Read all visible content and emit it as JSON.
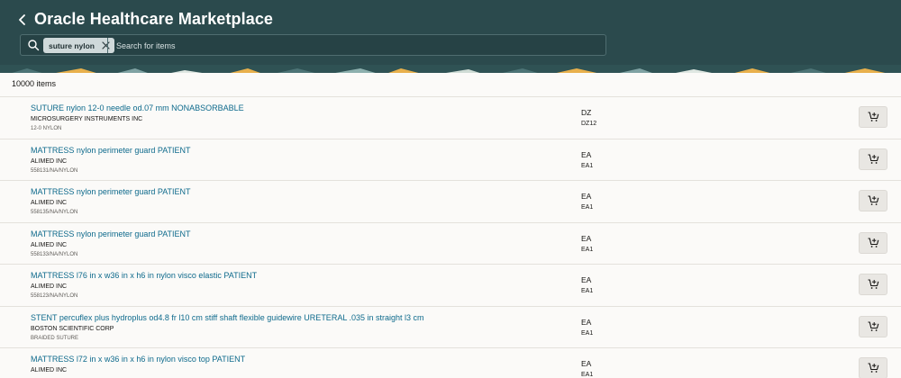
{
  "header": {
    "title": "Oracle Healthcare Marketplace",
    "back_icon": "chevron-left-icon"
  },
  "search": {
    "icon": "search-icon",
    "chip_label": "suture nylon",
    "placeholder": "Search for items",
    "value": ""
  },
  "results": {
    "count_label": "10000 items",
    "items": [
      {
        "title": "SUTURE nylon 12-0 needle od.07 mm NONABSORBABLE",
        "vendor": "MICROSURGERY INSTRUMENTS INC",
        "sku": "12-0 NYLON",
        "uom": "DZ",
        "pack": "DZ12"
      },
      {
        "title": "MATTRESS nylon perimeter guard PATIENT",
        "vendor": "ALIMED INC",
        "sku": "558131/NA/NYLON",
        "uom": "EA",
        "pack": "EA1"
      },
      {
        "title": "MATTRESS nylon perimeter guard PATIENT",
        "vendor": "ALIMED INC",
        "sku": "558135/NA/NYLON",
        "uom": "EA",
        "pack": "EA1"
      },
      {
        "title": "MATTRESS nylon perimeter guard PATIENT",
        "vendor": "ALIMED INC",
        "sku": "558133/NA/NYLON",
        "uom": "EA",
        "pack": "EA1"
      },
      {
        "title": "MATTRESS l76 in x w36 in x h6 in nylon visco elastic PATIENT",
        "vendor": "ALIMED INC",
        "sku": "558123/NA/NYLON",
        "uom": "EA",
        "pack": "EA1"
      },
      {
        "title": "STENT percuflex plus hydroplus od4.8 fr l10 cm stiff shaft flexible guidewire URETERAL .035 in straight l3 cm",
        "vendor": "BOSTON SCIENTIFIC CORP",
        "sku": "BRAIDED SUTURE",
        "uom": "EA",
        "pack": "EA1"
      },
      {
        "title": "MATTRESS l72 in x w36 in x h6 in nylon visco top PATIENT",
        "vendor": "ALIMED INC",
        "sku": "",
        "uom": "EA",
        "pack": "EA1"
      }
    ],
    "cart_icon": "add-to-cart-icon"
  },
  "colors": {
    "header_bg": "#2b4a4d",
    "link": "#0e6a8c",
    "banner_accent": "#e8b04c"
  }
}
